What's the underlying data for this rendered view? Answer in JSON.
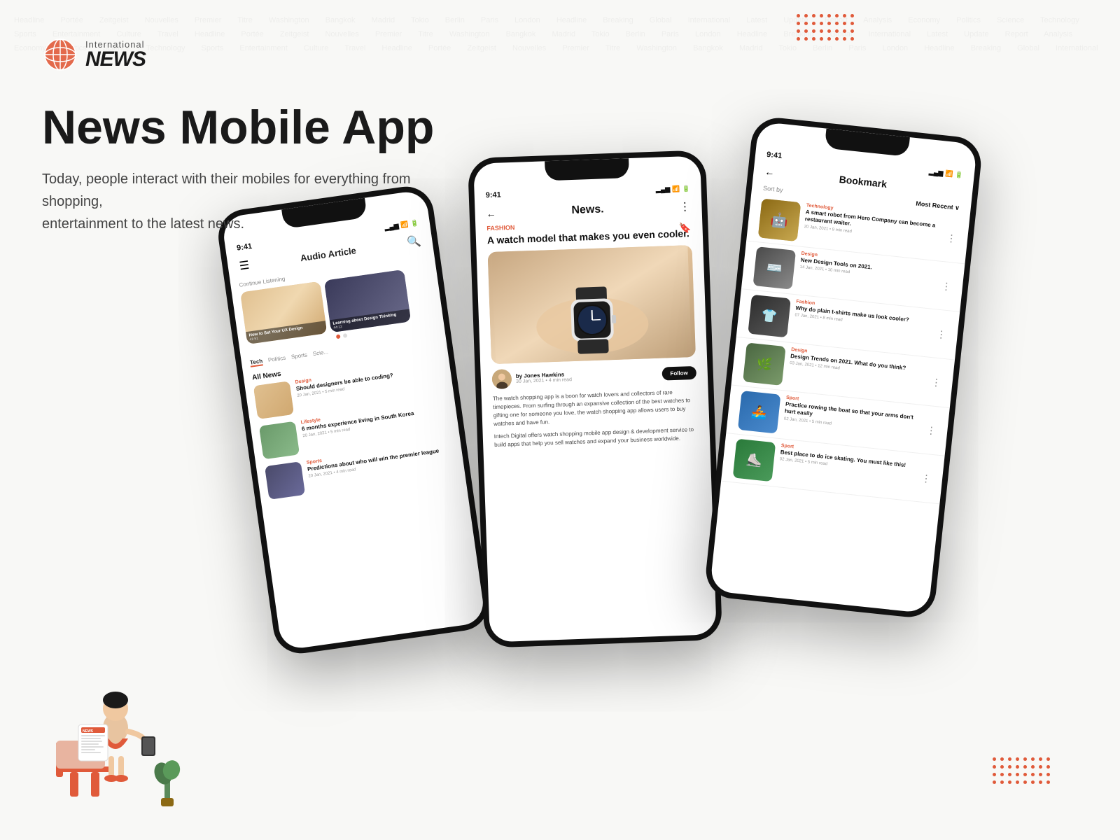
{
  "brand": {
    "international": "International",
    "news": "NEWS"
  },
  "hero": {
    "title": "News Mobile App",
    "subtitle_line1": "Today, people interact with their mobiles for everything from shopping,",
    "subtitle_line2": "entertainment to the latest news."
  },
  "phone_left": {
    "time": "9:41",
    "title": "Audio Article",
    "continue_label": "Continue Listening",
    "audio_cards": [
      {
        "title": "How to Set Your UX Design",
        "time": "41:51",
        "color": "thumb-img1"
      },
      {
        "title": "Learning about Design Thinking",
        "time": "44:12",
        "color": "thumb-img3"
      }
    ],
    "categories": [
      "Tech",
      "Politics",
      "Sports",
      "Scie"
    ],
    "active_category": "Tech",
    "all_news_label": "All News",
    "news_items": [
      {
        "category": "Design",
        "headline": "Should designers be able to coding?",
        "meta": "20 Jan, 2021 • 5 min read",
        "color": "thumb-img1"
      },
      {
        "category": "Lifestyle",
        "headline": "6 months experience living in South Korea",
        "meta": "20 Jan, 2021 • 5 min read",
        "color": "thumb-img2"
      },
      {
        "category": "Sports",
        "headline": "Predictions about who will win the premier league",
        "meta": "20 Jan, 2021 • 4 min read",
        "color": "thumb-img3"
      }
    ]
  },
  "phone_center": {
    "time": "9:41",
    "title": "News.",
    "article_category": "FASHION",
    "article_title": "A watch model that makes you even cooler.",
    "author_name": "by Jones Hawkins",
    "author_date": "30 Jan, 2021 • 4 min read",
    "follow_label": "Follow",
    "article_body_1": "The watch shopping app is a boon for watch lovers and collectors of rare timepieces. From surfing through an expansive collection of the best watches to gifting one for someone you love, the watch shopping app allows users to buy watches and have fun.",
    "article_body_2": "Intech Digital offers watch shopping mobile app design & development service to build apps that help you sell watches and expand your business worldwide."
  },
  "phone_right": {
    "time": "9:41",
    "title": "Bookmark",
    "sort_label": "Sort by",
    "sort_value": "Most Recent",
    "news_items": [
      {
        "category": "Technology",
        "headline": "A smart robot from Hero Company can become a restaurant waiter.",
        "meta": "20 Jan, 2021 • 9 min read",
        "color": "thumb-tech"
      },
      {
        "category": "Design",
        "headline": "New Design Tools on 2021.",
        "meta": "14 Jan, 2021 • 10 min read",
        "color": "thumb-design"
      },
      {
        "category": "Fashion",
        "headline": "Why do plain t-shirts make us look cooler?",
        "meta": "07 Jan, 2021 • 8 min read",
        "color": "thumb-fashion"
      },
      {
        "category": "Design",
        "headline": "Design Trends on 2021. What do you think?",
        "meta": "03 Jan, 2021 • 12 min read",
        "color": "thumb-design2"
      },
      {
        "category": "Sport",
        "headline": "Practice rowing the boat so that your arms don't hurt easily",
        "meta": "02 Jan, 2021 • 5 min read",
        "color": "thumb-sport"
      },
      {
        "category": "Sport",
        "headline": "Best place to do ice skating. You must like this!",
        "meta": "02 Jan, 2021 • 5 min read",
        "color": "thumb-sport2"
      }
    ]
  },
  "illustration": {
    "news_label": "NEWS"
  }
}
